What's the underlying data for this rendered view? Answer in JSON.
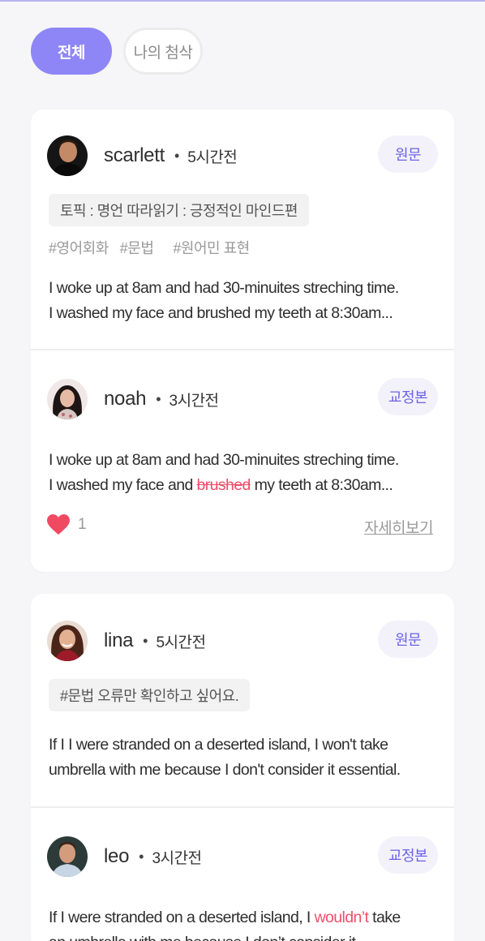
{
  "filters": {
    "all": "전체",
    "mine": "나의 첨삭"
  },
  "posts": [
    {
      "user": "scarlett",
      "time": "5시간전",
      "badge": "원문",
      "topic": "토픽 :  명언 따라읽기 : 긍정적인 마인드편",
      "tags": [
        "#영어회화",
        "#문법",
        "#원어민 표현"
      ],
      "line1": "I woke up at 8am and had 30-minuites streching time.",
      "line2": "I washed my face and brushed my teeth at 8:30am..."
    },
    {
      "user": "noah",
      "time": "3시간전",
      "badge": "교정본",
      "line1": "I woke up at 8am and had 30-minuites streching time.",
      "line2_pre": "I washed my face and ",
      "line2_strike": "brushed",
      "line2_post": " my teeth at 8:30am...",
      "likes": "1",
      "more": "자세히보기"
    },
    {
      "user": "lina",
      "time": "5시간전",
      "badge": "원문",
      "topic": "#문법 오류만 확인하고 싶어요.",
      "line1": "If I I were stranded on a deserted island, I won't take",
      "line2": "umbrella with me because I don't consider it essential."
    },
    {
      "user": "leo",
      "time": "3시간전",
      "badge": "교정본",
      "line1_pre": "If I were stranded on a deserted island, I ",
      "line1_red": "wouldn’t",
      "line1_post": " take",
      "line2": "an umbrella with me because I don’t consider it"
    }
  ],
  "colors": {
    "accent": "#8e86f6",
    "badge_text": "#6b62e6",
    "correction": "#ef4f6a",
    "heart": "#f04a63"
  }
}
